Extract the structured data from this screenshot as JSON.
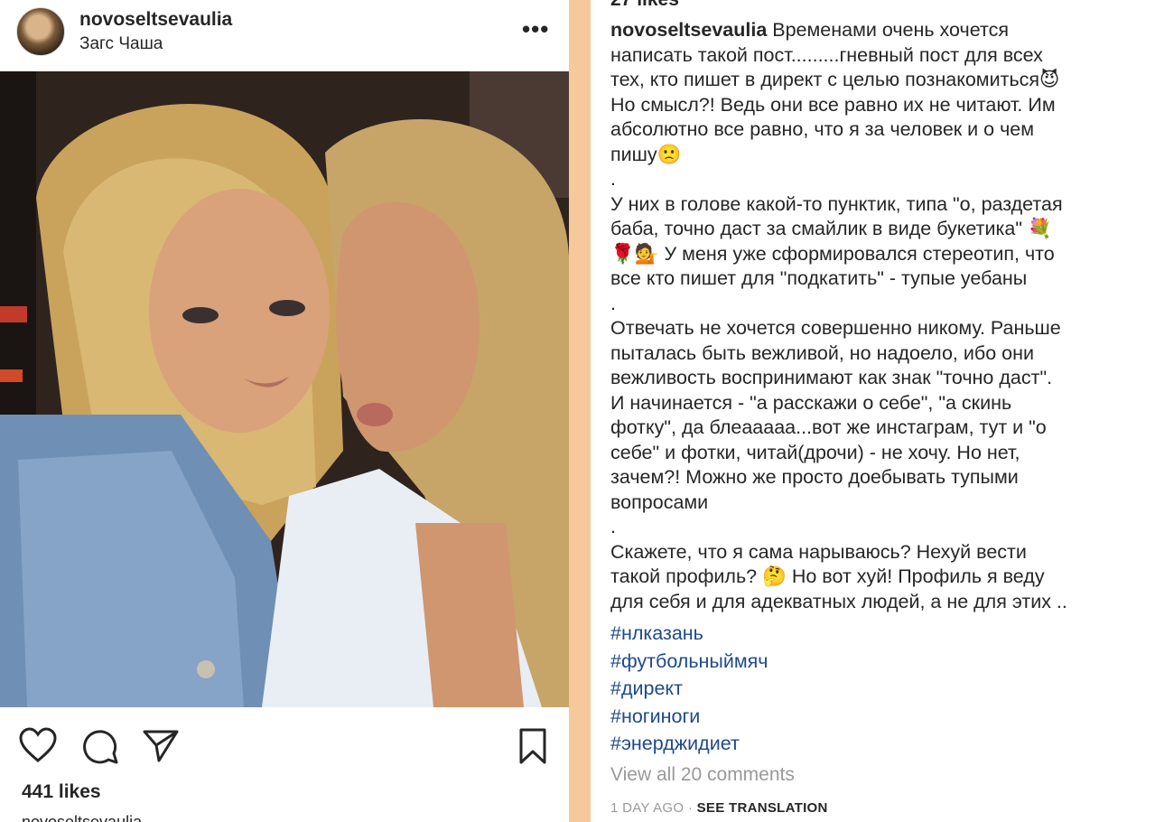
{
  "post": {
    "username": "novoseltsevaulia",
    "location": "Загс Чаша",
    "more_label": "•••",
    "likes": "441 likes",
    "caption_peek": "novoseltsevaulia"
  },
  "caption": {
    "top_cut": "27 likes",
    "username": "novoseltsevaulia",
    "text": " Временами очень хочется\nнаписать такой пост.........гневный пост для всех\nтех, кто пишет в директ с целью познакомиться😈\nНо смысл?! Ведь они все равно их не читают. Им\nабсолютно все равно, что я за человек и о чем\nпишу🙁\n.\nУ них в голове какой-то пунктик, типа \"о, раздетая\nбаба, точно даст за смайлик в виде букетика\" 💐\n🌹💁 У меня уже сформировался стереотип, что\nвсе кто пишет для \"подкатить\" - тупые уебаны\n.\nОтвечать не хочется совершенно никому. Раньше\nпыталась быть вежливой, но надоело, ибо они\nвежливость воспринимают как знак \"точно даст\".\nИ начинается - \"а расскажи о себе\", \"а скинь\nфотку\", да блеааааа...вот же инстаграм, тут и \"о\nсебе\" и фотки, читай(дрочи) - не хочу. Но нет,\nзачем?! Можно же просто доебывать тупыми\nвопросами\n.\nСкажете, что я сама нарываюсь? Нехуй вести\nтакой профиль? 🤔 Но вот хуй! Профиль я веду\nдля себя и для адекватных людей, а не для этих ..",
    "hashtags": [
      "#нлказань",
      "#футбольныймяч",
      "#директ",
      "#ногиноги",
      "#энерджидиет"
    ],
    "view_all": "View all 20 comments",
    "time": "1 DAY AGO",
    "sep": " · ",
    "translation": "SEE TRANSLATION"
  },
  "colors": {
    "divider": "#f6c99a",
    "hashtag": "#1e4a8a",
    "muted": "#999999"
  },
  "icons": [
    "heart-icon",
    "comment-icon",
    "share-icon",
    "bookmark-icon",
    "more-icon"
  ]
}
